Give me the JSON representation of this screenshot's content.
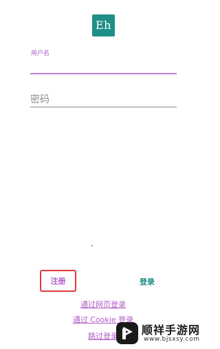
{
  "logo": {
    "text": "Eh",
    "color": "#1f8e86"
  },
  "form": {
    "username_label": "用户名",
    "username_value": "",
    "password_placeholder": "密码",
    "password_value": ""
  },
  "actions": {
    "register_label": "注册",
    "login_label": "登录"
  },
  "links": {
    "web_login": "通过网页登录",
    "cookie_login": "通过 Cookie 登录",
    "skip_login": "跳过登录"
  },
  "watermark": {
    "title": "顺祥手游网",
    "url": "www.bjsxsy.com"
  },
  "colors": {
    "accent": "#b15bc7",
    "primary": "#1f8e86",
    "highlight_box": "#e0393b"
  }
}
